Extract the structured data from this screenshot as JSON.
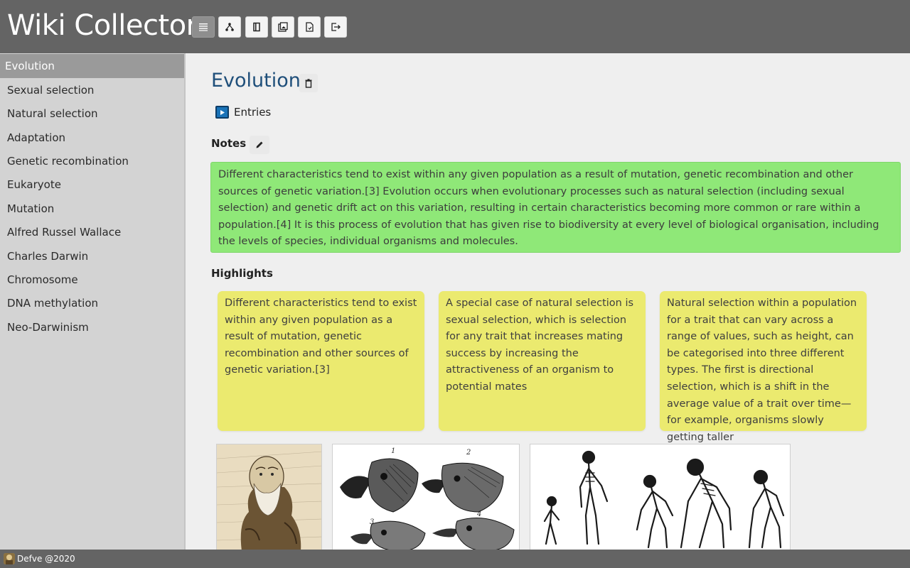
{
  "app": {
    "title": "Wiki Collector"
  },
  "toolbar": {
    "buttons": [
      {
        "icon": "list-icon",
        "active": true
      },
      {
        "icon": "tree-icon",
        "active": false
      },
      {
        "icon": "notebook-icon",
        "active": false
      },
      {
        "icon": "gallery-icon",
        "active": false
      },
      {
        "icon": "document-icon",
        "active": false
      },
      {
        "icon": "export-icon",
        "active": false
      }
    ]
  },
  "sidebar": {
    "items": [
      {
        "label": "Evolution",
        "selected": true
      },
      {
        "label": "Sexual selection"
      },
      {
        "label": "Natural selection"
      },
      {
        "label": "Adaptation"
      },
      {
        "label": "Genetic recombination"
      },
      {
        "label": "Eukaryote"
      },
      {
        "label": "Mutation"
      },
      {
        "label": "Alfred Russel Wallace"
      },
      {
        "label": "Charles Darwin"
      },
      {
        "label": "Chromosome"
      },
      {
        "label": "DNA methylation"
      },
      {
        "label": "Neo-Darwinism"
      }
    ]
  },
  "main": {
    "title": "Evolution",
    "entries_label": "Entries",
    "notes_label": "Notes",
    "notes_text": "Different characteristics tend to exist within any given population as a result of mutation, genetic recombination and other sources of genetic variation.[3] Evolution occurs when evolutionary processes such as natural selection (including sexual selection) and genetic drift act on this variation, resulting in certain characteristics becoming more common or rare within a population.[4] It is this process of evolution that has given rise to biodiversity at every level of biological organisation, including the levels of species, individual organisms and molecules.",
    "highlights_label": "Highlights",
    "highlights": [
      "Different characteristics tend to exist within any given population as a result of mutation, genetic recombination and other sources of genetic variation.[3]",
      "A special case of natural selection is sexual selection, which is selection for any trait that increases mating success by increasing the attractiveness of an organism to potential mates",
      "Natural selection within a population for a trait that can vary across a range of values, such as height, can be categorised into three different types. The first is directional selection, which is a shift in the average value of a trait over time—for example, organisms slowly getting taller"
    ],
    "images": [
      {
        "name": "darwin-caricature-image"
      },
      {
        "name": "finch-beaks-image",
        "labels": [
          "1",
          "2",
          "3",
          "4"
        ]
      },
      {
        "name": "primate-skeletons-image"
      }
    ]
  },
  "footer": {
    "text": "Defve @2020"
  },
  "colors": {
    "header_bg": "#646464",
    "sidebar_bg": "#d3d3d3",
    "sidebar_selected": "#9a9a9a",
    "title_blue": "#1f4f7a",
    "notes_green": "#8fe878",
    "highlight_yellow": "#ebea6f"
  }
}
